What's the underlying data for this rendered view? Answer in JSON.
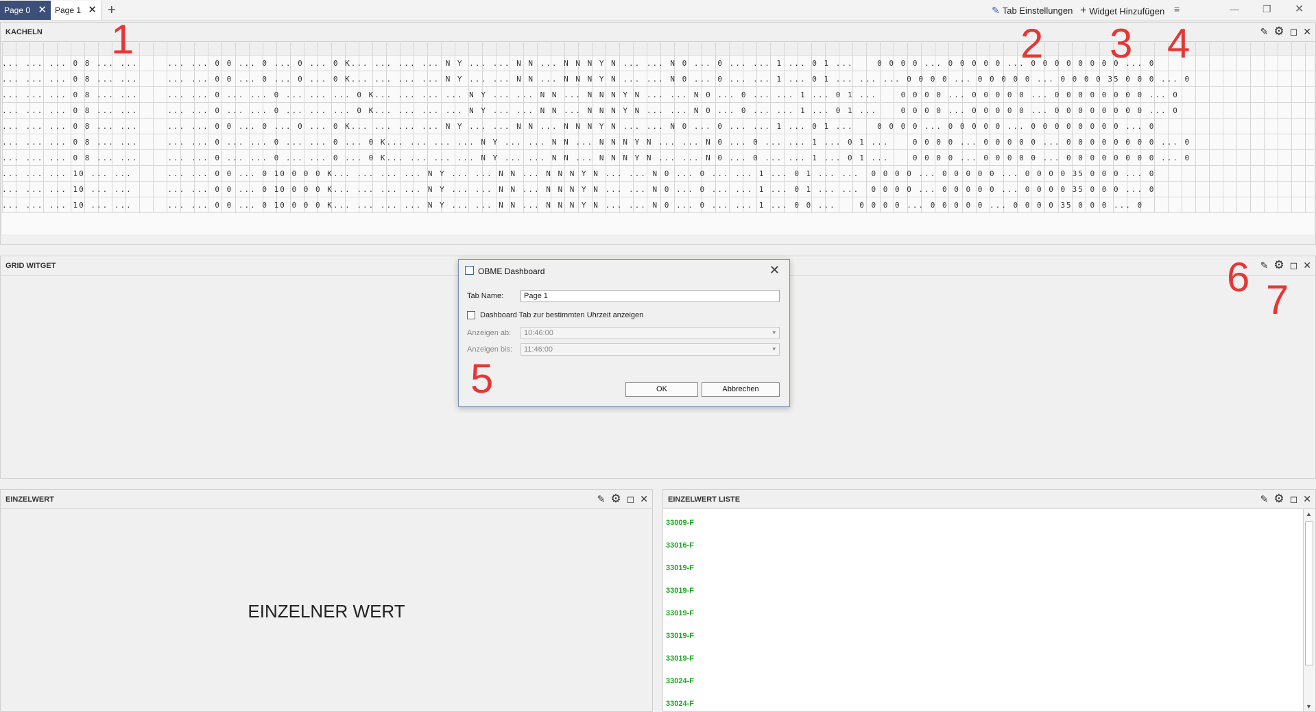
{
  "tabs": [
    {
      "label": "Page 0",
      "active": true
    },
    {
      "label": "Page 1",
      "active": false
    }
  ],
  "toolbar": {
    "tab_settings": "Tab Einstellungen",
    "add_widget": "Widget Hinzufügen"
  },
  "panels": {
    "kacheln": {
      "title": "KACHELN"
    },
    "grid": {
      "title": "GRID WITGET"
    },
    "einzelwert": {
      "title": "EINZELWERT",
      "value": "EINZELNER WERT"
    },
    "liste": {
      "title": "EINZELWERT LISTE"
    }
  },
  "kacheln_rows": [
    "... ... ... 0 8 ... ...     ... ... 0 0 ... 0 ... 0 ... 0 K... ... ... ... N Y ... ... N N ... N N N Y N ... ... N 0 ... 0 ... ... 1 ... 0 1 ...    0 0 0 0 ... 0 0 0 0 0 ... 0 0 0 0 0 0 0 0 ... 0",
    "... ... ... 0 8 ... ...     ... ... 0 0 ... 0 ... 0 ... 0 K... ... ... ... N Y ... ... N N ... N N N Y N ... ... N 0 ... 0 ... ... 1 ... 0 1 ... ... ... 0 0 0 0 ... 0 0 0 0 0 ... 0 0 0 0 35 0 0 0 ... 0",
    "... ... ... 0 8 ... ...     ... ... 0 ... ... 0 ... ... ... 0 K... ... ... ... N Y ... ... N N ... N N N Y N ... ... N 0 ... 0 ... ... 1 ... 0 1 ...    0 0 0 0 ... 0 0 0 0 0 ... 0 0 0 0 0 0 0 0 ... 0",
    "... ... ... 0 8 ... ...     ... ... 0 ... ... 0 ... ... ... 0 K... ... ... ... N Y ... ... N N ... N N N Y N ... ... N 0 ... 0 ... ... 1 ... 0 1 ...    0 0 0 0 ... 0 0 0 0 0 ... 0 0 0 0 0 0 0 0 ... 0",
    "... ... ... 0 8 ... ...     ... ... 0 0 ... 0 ... 0 ... 0 K... ... ... ... N Y ... ... N N ... N N N Y N ... ... N 0 ... 0 ... ... 1 ... 0 1 ...    0 0 0 0 ... 0 0 0 0 0 ... 0 0 0 0 0 0 0 0 ... 0",
    "... ... ... 0 8 ... ...     ... ... 0 ... ... 0 ... ... 0 ... 0 K... ... ... ... N Y ... ... N N ... N N N Y N ... ... N 0 ... 0 ... ... 1 ... 0 1 ...    0 0 0 0 ... 0 0 0 0 0 ... 0 0 0 0 0 0 0 0 ... 0",
    "... ... ... 0 8 ... ...     ... ... 0 ... ... 0 ... ... 0 ... 0 K... ... ... ... N Y ... ... N N ... N N N Y N ... ... N 0 ... 0 ... ... 1 ... 0 1 ...    0 0 0 0 ... 0 0 0 0 0 ... 0 0 0 0 0 0 0 0 ... 0",
    "... ... ... 10 ... ...      ... ... 0 0 ... 0 10 0 0 0 K... ... ... ... N Y ... ... N N ... N N N Y N ... ... N 0 ... 0 ... ... 1 ... 0 1 ... ...  0 0 0 0 ... 0 0 0 0 0 ... 0 0 0 0 35 0 0 0 ... 0",
    "... ... ... 10 ... ...      ... ... 0 0 ... 0 10 0 0 0 K... ... ... ... N Y ... ... N N ... N N N Y N ... ... N 0 ... 0 ... ... 1 ... 0 1 ... ...  0 0 0 0 ... 0 0 0 0 0 ... 0 0 0 0 35 0 0 0 ... 0",
    "... ... ... 10 ... ...      ... ... 0 0 ... 0 10 0 0 0 K... ... ... ... N Y ... ... N N ... N N N Y N ... ... N 0 ... 0 ... ... 1 ... 0 0 ...    0 0 0 0 ... 0 0 0 0 0 ... 0 0 0 0 35 0 0 0 ... 0"
  ],
  "annotations": [
    "1",
    "2",
    "3",
    "4",
    "5",
    "6",
    "7"
  ],
  "dialog": {
    "title": "OBME Dashboard",
    "tab_name_label": "Tab Name:",
    "tab_name_value": "Page 1",
    "checkbox_label": "Dashboard Tab zur bestimmten Uhrzeit anzeigen",
    "show_from_label": "Anzeigen ab:",
    "show_from_value": "10:46:00",
    "show_until_label": "Anzeigen bis:",
    "show_until_value": "11:46:00",
    "ok": "OK",
    "cancel": "Abbrechen"
  },
  "list_items": [
    "33009-F",
    "33016-F",
    "33019-F",
    "33019-F",
    "33019-F",
    "33019-F",
    "33019-F",
    "33024-F",
    "33024-F"
  ],
  "colors": {
    "active_tab": "#3b4f78",
    "list_text": "#17a81b",
    "annotation": "#e63636"
  }
}
